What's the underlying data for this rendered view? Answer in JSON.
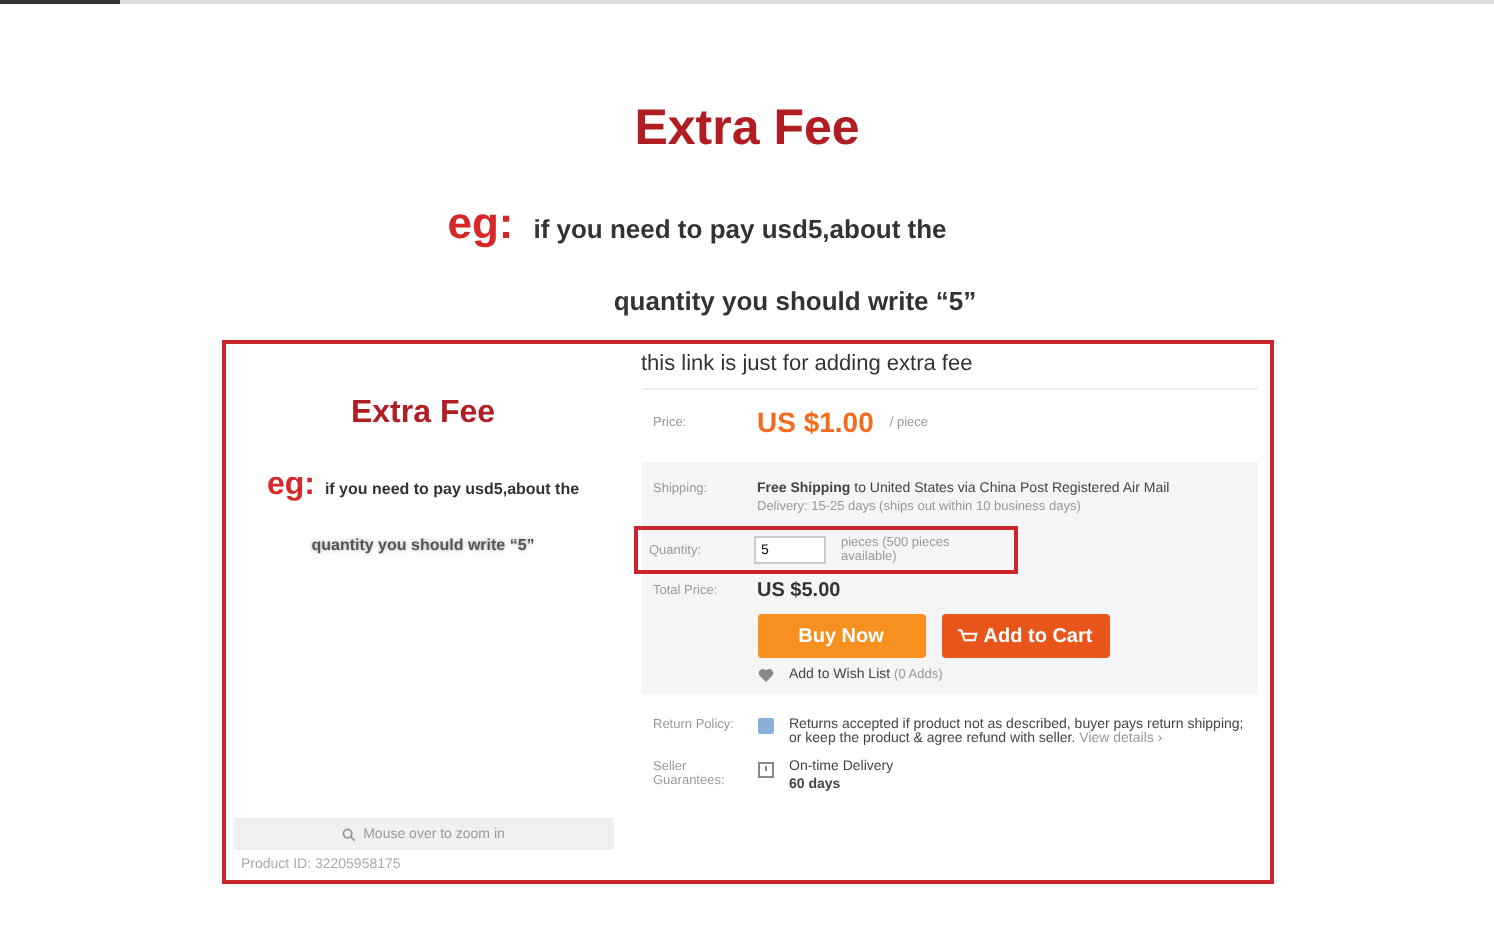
{
  "heading": {
    "title": "Extra Fee",
    "eg": "eg:",
    "line_1": "if you need to pay usd5,about the",
    "line_2": "quantity you should write “5”"
  },
  "listing": {
    "gallery": {
      "title": "Extra Fee",
      "eg": "eg:",
      "line_1": "if you need to pay usd5,about the",
      "line_2": "quantity you should write “5”",
      "zoom_hint": "Mouse over to zoom in",
      "product_id": "Product ID: 32205958175"
    },
    "title": "this link is just for adding extra fee",
    "price": {
      "label": "Price:",
      "value": "US $1.00",
      "unit": "/ piece"
    },
    "shipping": {
      "label": "Shipping:",
      "free": "Free Shipping",
      "detail": "to United States via China Post Registered Air Mail",
      "delivery": "Delivery: 15-25 days (ships out within 10 business days)"
    },
    "quantity": {
      "label": "Quantity:",
      "value": "5",
      "note": "pieces (500 pieces available)",
      "highlighted": true
    },
    "total": {
      "label": "Total Price:",
      "value": "US $5.00"
    },
    "buttons": [
      {
        "label": "Buy Now",
        "kind": "buy"
      },
      {
        "label": "Add to Cart",
        "kind": "cart"
      }
    ],
    "wish_list": {
      "label": "Add to Wish List",
      "count": "(0 Adds)"
    },
    "return_policy": {
      "label": "Return Policy:",
      "text": "Returns accepted if product not as described, buyer pays return shipping; or keep the product & agree refund with seller.",
      "link": "View details ›"
    },
    "guarantees": {
      "label": "Seller Guarantees:",
      "name": "On-time Delivery",
      "days": "60 days"
    }
  }
}
